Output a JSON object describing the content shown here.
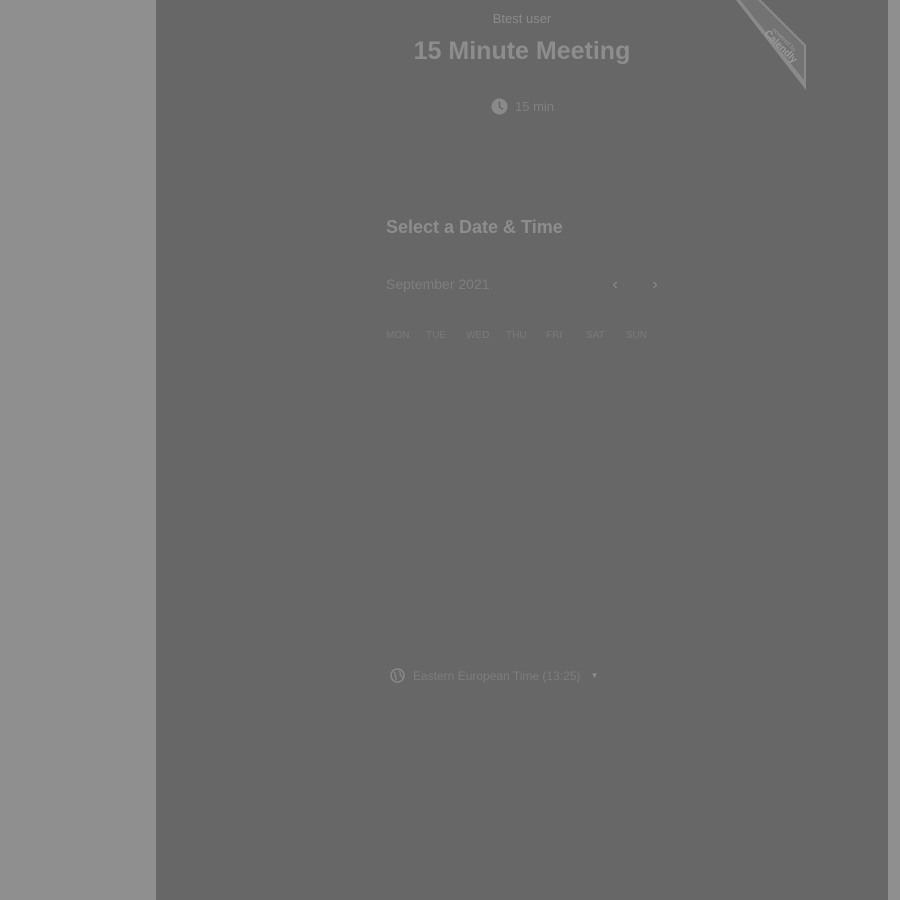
{
  "event": {
    "owner": "Btest user",
    "title": "15 Minute Meeting",
    "duration": "15 min"
  },
  "ribbon": {
    "powered_by": "powered by",
    "brand": "Calendly"
  },
  "scheduler": {
    "heading": "Select a Date & Time",
    "month": "September 2021",
    "prev_icon": "‹",
    "next_icon": "›",
    "weekdays": [
      "MON",
      "TUE",
      "WED",
      "THU",
      "FRI",
      "SAT",
      "SUN"
    ]
  },
  "timezone": {
    "label": "Eastern European Time (13:25)",
    "caret": "▼"
  },
  "colors": {
    "overlay_dark": "#676767",
    "overlay_light": "#8f8f8f"
  }
}
